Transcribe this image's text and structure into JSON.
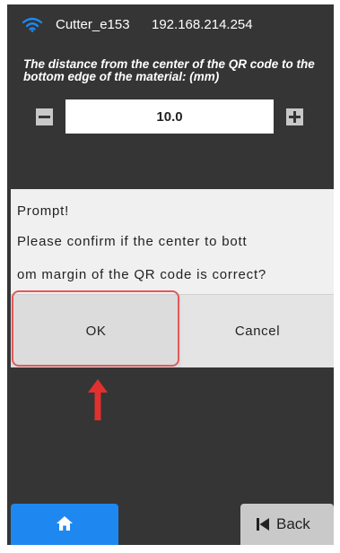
{
  "status_bar": {
    "device_name": "Cutter_e153",
    "ip_address": "192.168.214.254",
    "wifi_icon": "wifi-icon",
    "wifi_color": "#1e88f0"
  },
  "setting": {
    "label": "The distance from the center of the QR code to the bottom edge of the material: (mm)",
    "value": "10.0",
    "minus_icon": "minus-icon",
    "plus_icon": "plus-icon"
  },
  "dialog": {
    "title": "Prompt!",
    "message_line1": "Please confirm if the center to bott",
    "message_line2": "om margin of the QR code is correct?",
    "ok_label": "OK",
    "cancel_label": "Cancel",
    "highlight_color": "#e05a5a"
  },
  "bottom_nav": {
    "home_icon": "home-icon",
    "home_color": "#1e88f0",
    "back_icon": "skip-back-icon",
    "back_label": "Back"
  }
}
